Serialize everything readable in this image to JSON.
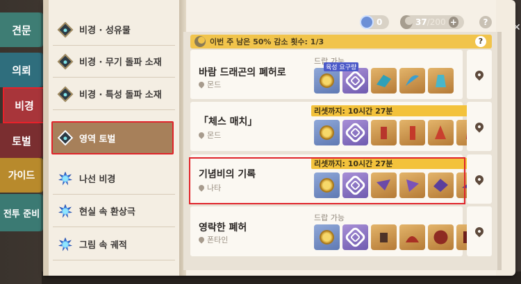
{
  "tabs": [
    "견문",
    "의뢰",
    "비경",
    "토벌",
    "가이드",
    "전투 준비"
  ],
  "menu": [
    {
      "label": "비경 · 성유물",
      "icon": "domain-diamond-icon"
    },
    {
      "label": "비경 · 무기 돌파 소재",
      "icon": "domain-diamond-icon"
    },
    {
      "label": "비경 · 특성 돌파 소재",
      "icon": "domain-diamond-icon"
    },
    {
      "label": "영역 토벌",
      "icon": "domain-diamond-icon"
    },
    {
      "label": "나선 비경",
      "icon": "spiral-abyss-icon"
    },
    {
      "label": "현실 속 환상극",
      "icon": "theater-icon"
    },
    {
      "label": "그림 속 궤적",
      "icon": "painting-icon"
    }
  ],
  "header": {
    "currency_a": "0",
    "resin": "37",
    "resin_max": "/200",
    "plus": "+",
    "help": "?"
  },
  "notice": {
    "text": "이번 주 남은 50% 감소 횟수: 1/3",
    "help": "?"
  },
  "cards": [
    {
      "title": "바람 드래곤의 폐허로",
      "location": "몬드",
      "drop_label": "드랍 가능",
      "badge": "육성 요구량"
    },
    {
      "title": "「체스 매치」",
      "location": "몬드",
      "reset": "리셋까지: 10시간 27분"
    },
    {
      "title": "기념비의 기록",
      "location": "나타",
      "reset": "리셋까지: 10시간 27분"
    },
    {
      "title": "영락한 폐허",
      "location": "폰타인",
      "drop_label": "드랍 가능"
    }
  ],
  "colors": {
    "tab_selected": "#a8353a",
    "highlight": "#e0232a",
    "notice": "#f1c44b"
  }
}
